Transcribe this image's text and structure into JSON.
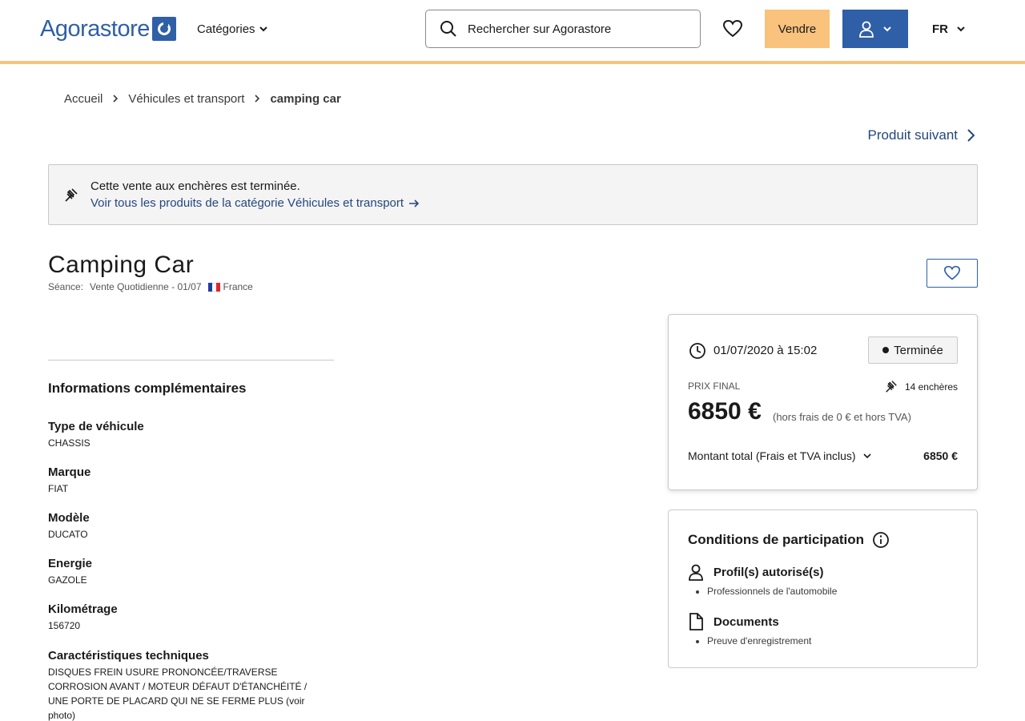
{
  "header": {
    "logo_text": "Agorastore",
    "categories_label": "Catégories",
    "search_placeholder": "Rechercher sur Agorastore",
    "sell_label": "Vendre",
    "language": "FR"
  },
  "breadcrumb": {
    "items": [
      "Accueil",
      "Véhicules et transport",
      "camping car"
    ]
  },
  "next_product_label": "Produit suivant",
  "notice": {
    "line1": "Cette vente aux enchères est terminée.",
    "line2": "Voir tous les produits de la catégorie Véhicules et transport"
  },
  "product": {
    "title": "Camping Car",
    "session_label": "Séance:",
    "session_value": "Vente Quotidienne - 01/07",
    "country": "France"
  },
  "info": {
    "title": "Informations complémentaires",
    "attributes": [
      {
        "key": "Type de véhicule",
        "value": "CHASSIS"
      },
      {
        "key": "Marque",
        "value": "FIAT"
      },
      {
        "key": "Modèle",
        "value": "DUCATO"
      },
      {
        "key": "Energie",
        "value": "GAZOLE"
      },
      {
        "key": "Kilométrage",
        "value": "156720"
      },
      {
        "key": "Caractéristiques techniques",
        "value": "DISQUES FREIN USURE PRONONCÉE/TRAVERSE CORROSION AVANT / MOTEUR DÉFAUT D'ÉTANCHÉITÉ / UNE PORTE DE PLACARD QUI NE SE FERME PLUS (voir photo)"
      }
    ]
  },
  "auction": {
    "date": "01/07/2020 à 15:02",
    "status": "Terminée",
    "price_label": "PRIX FINAL",
    "bids": "14 enchères",
    "price": "6850 €",
    "price_note": "(hors frais de 0 € et hors TVA)",
    "total_label": "Montant total (Frais et TVA inclus)",
    "total_value": "6850 €"
  },
  "conditions": {
    "title": "Conditions de participation",
    "profiles_label": "Profil(s) autorisé(s)",
    "profiles": [
      "Professionnels de l'automobile"
    ],
    "documents_label": "Documents",
    "documents": [
      "Preuve d'enregistrement"
    ]
  },
  "colors": {
    "brand_blue": "#2f5fa7",
    "link_blue": "#24477f",
    "accent_orange": "#f9c27d"
  }
}
